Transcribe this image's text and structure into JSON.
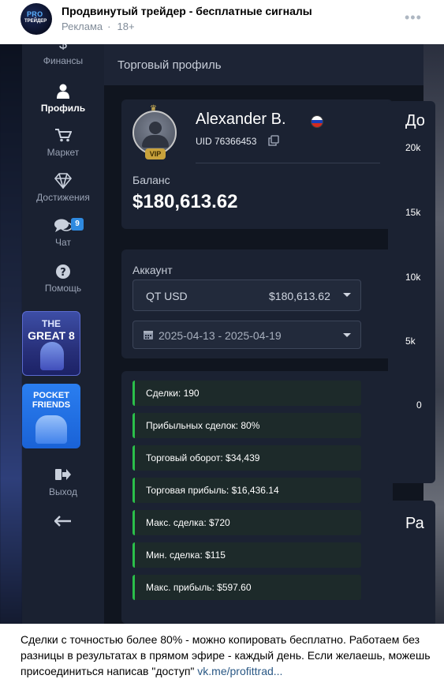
{
  "post": {
    "title": "Продвинутый трейдер - бесплатные сигналы",
    "ad_label": "Реклама",
    "age": "18+",
    "avatar_text_1": "PRO",
    "avatar_text_2": "ТРЕЙДЕР",
    "text": "Сделки с точностью более 80% - можно копировать бесплатно. Работаем без разницы в результатах в прямом эфире - каждый день. Если желаешь, можешь присоединиться написав \"доступ\"",
    "link": "vk.me/profittrad..."
  },
  "app": {
    "page_title": "Торговый профиль",
    "nav": [
      {
        "label": "Финансы",
        "icon": "dollar-icon"
      },
      {
        "label": "Профиль",
        "icon": "user-icon",
        "active": true
      },
      {
        "label": "Маркет",
        "icon": "cart-icon"
      },
      {
        "label": "Достижения",
        "icon": "diamond-icon"
      },
      {
        "label": "Чат",
        "icon": "chat-icon",
        "badge": "9"
      },
      {
        "label": "Помощь",
        "icon": "help-icon"
      },
      {
        "label": "Выход",
        "icon": "logout-icon"
      }
    ],
    "promos": [
      {
        "line1": "THE",
        "line2": "GREAT 8"
      },
      {
        "line1": "POCKET",
        "line2": "FRIENDS"
      }
    ],
    "profile": {
      "name": "Alexander B.",
      "uid": "UID 76366453",
      "vip": "VIP",
      "balance_label": "Баланс",
      "balance": "$180,613.62"
    },
    "account": {
      "label": "Аккаунт",
      "selected_account": "QT USD",
      "selected_balance": "$180,613.62",
      "date_range": "2025-04-13 - 2025-04-19"
    },
    "stats": [
      "Сделки: 190",
      "Прибыльных сделок: 80%",
      "Торговый оборот: $34,439",
      "Торговая прибыль: $16,436.14",
      "Макс. сделка: $720",
      "Мин. сделка: $115",
      "Макс. прибыль: $597.60"
    ],
    "chart": {
      "title_fragment": "До",
      "ticks": [
        "20k",
        "15k",
        "10k",
        "5k",
        "0"
      ],
      "second_title_fragment": "Ра"
    }
  }
}
